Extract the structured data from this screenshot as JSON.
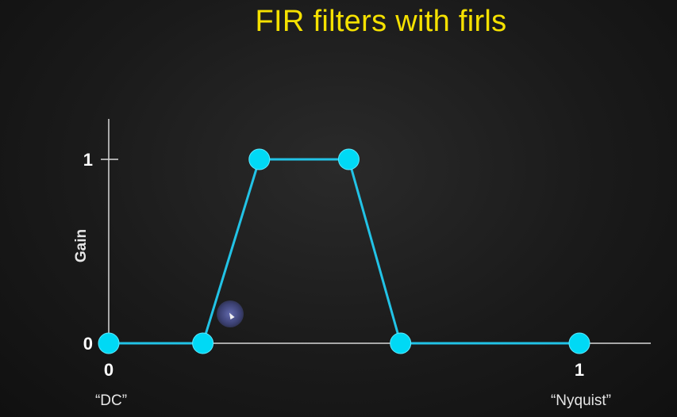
{
  "slide": {
    "title": "FIR filters with firls"
  },
  "colors": {
    "title": "#f5e100",
    "line": "#22c3e6",
    "marker": "#00d9f5",
    "axis": "#d8d8d8",
    "text": "#ffffff"
  },
  "chart_data": {
    "type": "line",
    "title": "",
    "xlabel": "",
    "ylabel": "Gain",
    "xlim": [
      0,
      1
    ],
    "ylim": [
      0,
      1
    ],
    "x_ticks": [
      {
        "value": 0,
        "label": "0",
        "annotation": "“DC”"
      },
      {
        "value": 1,
        "label": "1",
        "annotation": "“Nyquist”"
      }
    ],
    "y_ticks": [
      {
        "value": 0,
        "label": "0"
      },
      {
        "value": 1,
        "label": "1"
      }
    ],
    "grid": false,
    "legend": false,
    "series": [
      {
        "x": [
          0,
          0.2,
          0.32,
          0.51,
          0.62,
          1.0
        ],
        "y": [
          0,
          0,
          1,
          1,
          0,
          0
        ]
      }
    ]
  }
}
